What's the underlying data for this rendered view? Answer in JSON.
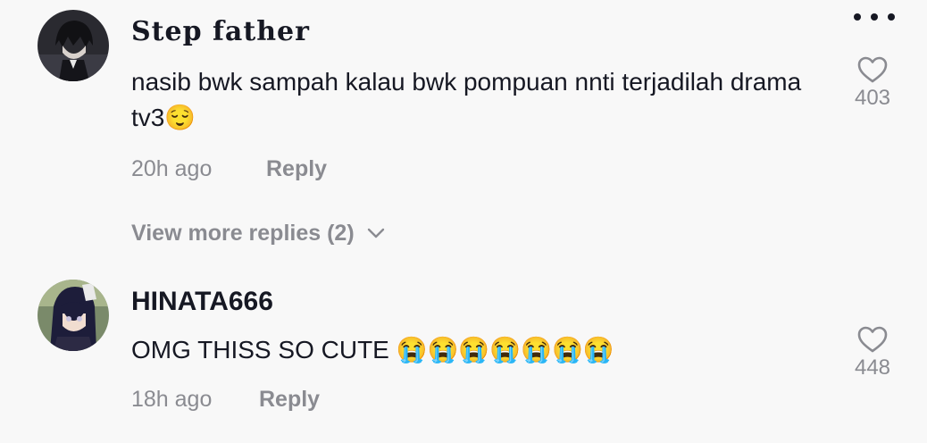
{
  "comments": [
    {
      "username": "Step father",
      "text": "nasib bwk sampah kalau bwk pompuan nnti terjadilah drama tv3😌",
      "time": "20h ago",
      "reply_label": "Reply",
      "likes": "403",
      "view_more": "View more replies (2)"
    },
    {
      "username": "HINATA666",
      "text": "OMG THISS SO CUTE 😭😭😭😭😭😭😭",
      "time": "18h ago",
      "reply_label": "Reply",
      "likes": "448"
    }
  ],
  "icons": {
    "more": "more-options-icon",
    "like": "heart-outline-icon",
    "expand": "chevron-down-icon"
  }
}
